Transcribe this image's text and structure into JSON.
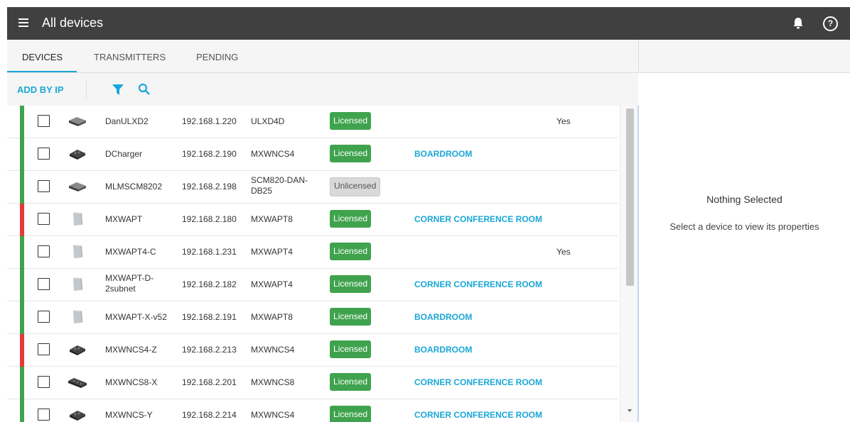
{
  "header": {
    "title": "All devices",
    "menu_icon": "hamburger-menu-icon",
    "bell_icon": "bell-icon",
    "help_icon": "help-circle-icon",
    "help_glyph": "?"
  },
  "tabs": [
    {
      "label": "DEVICES",
      "active": true
    },
    {
      "label": "TRANSMITTERS",
      "active": false
    },
    {
      "label": "PENDING",
      "active": false
    }
  ],
  "toolbar": {
    "add_label": "ADD BY IP",
    "filter_icon": "filter-icon",
    "search_icon": "search-icon"
  },
  "colors": {
    "accent": "#1aa7d8",
    "status_green": "#3fa34d",
    "status_red": "#e53935",
    "licensed_badge": "#3fa34d",
    "unlicensed_badge": "#d9d9d9"
  },
  "devices": [
    {
      "status": "green",
      "icon": "receiver-device-icon",
      "name": "DanULXD2",
      "ip": "192.168.1.220",
      "model": "ULXD4D",
      "license": "Licensed",
      "location": "",
      "yes": "Yes"
    },
    {
      "status": "green",
      "icon": "charger-device-icon",
      "name": "DCharger",
      "ip": "192.168.2.190",
      "model": "MXWNCS4",
      "license": "Licensed",
      "location": "BOARDROOM",
      "yes": ""
    },
    {
      "status": "green",
      "icon": "receiver-device-icon",
      "name": "MLMSCM8202",
      "ip": "192.168.2.198",
      "model": "SCM820-DAN-DB25",
      "license": "Unlicensed",
      "location": "",
      "yes": ""
    },
    {
      "status": "red",
      "icon": "access-point-icon",
      "name": "MXWAPT",
      "ip": "192.168.2.180",
      "model": "MXWAPT8",
      "license": "Licensed",
      "location": "CORNER CONFERENCE ROOM",
      "yes": ""
    },
    {
      "status": "green",
      "icon": "access-point-icon",
      "name": "MXWAPT4-C",
      "ip": "192.168.1.231",
      "model": "MXWAPT4",
      "license": "Licensed",
      "location": "",
      "yes": "Yes"
    },
    {
      "status": "green",
      "icon": "access-point-icon",
      "name": "MXWAPT-D-2subnet",
      "ip": "192.168.2.182",
      "model": "MXWAPT4",
      "license": "Licensed",
      "location": "CORNER CONFERENCE ROOM",
      "yes": ""
    },
    {
      "status": "green",
      "icon": "access-point-icon",
      "name": "MXWAPT-X-v52",
      "ip": "192.168.2.191",
      "model": "MXWAPT8",
      "license": "Licensed",
      "location": "BOARDROOM",
      "yes": ""
    },
    {
      "status": "red",
      "icon": "charger-device-icon",
      "name": "MXWNCS4-Z",
      "ip": "192.168.2.213",
      "model": "MXWNCS4",
      "license": "Licensed",
      "location": "BOARDROOM",
      "yes": ""
    },
    {
      "status": "green",
      "icon": "charger-long-device-icon",
      "name": "MXWNCS8-X",
      "ip": "192.168.2.201",
      "model": "MXWNCS8",
      "license": "Licensed",
      "location": "CORNER CONFERENCE ROOM",
      "yes": ""
    },
    {
      "status": "green",
      "icon": "charger-device-icon",
      "name": "MXWNCS-Y",
      "ip": "192.168.2.214",
      "model": "MXWNCS4",
      "license": "Licensed",
      "location": "CORNER CONFERENCE ROOM",
      "yes": ""
    }
  ],
  "details": {
    "title": "Nothing Selected",
    "subtitle": "Select a device to view its properties"
  }
}
